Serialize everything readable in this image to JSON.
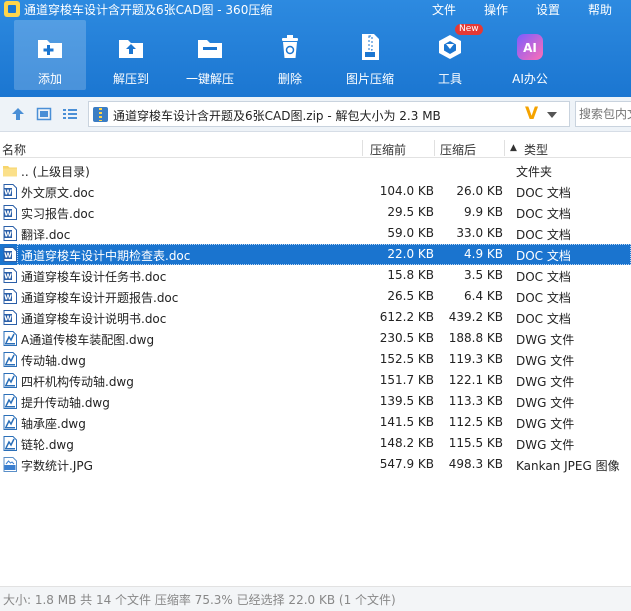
{
  "window": {
    "title": "通道穿梭车设计含开题及6张CAD图 - 360压缩"
  },
  "menu": {
    "file": "文件",
    "action": "操作",
    "settings": "设置",
    "help": "帮助"
  },
  "toolbar": {
    "add": "添加",
    "extract_to": "解压到",
    "one_click_extract": "一键解压",
    "delete": "删除",
    "image_compress": "图片压缩",
    "tools": "工具",
    "tools_badge": "New",
    "ai_office": "AI办公",
    "ai_icon_text": "AI"
  },
  "address": {
    "path": "通道穿梭车设计含开题及6张CAD图.zip - 解包大小为 2.3 MB",
    "v_glyph": "V",
    "search_placeholder": "搜索包内文件"
  },
  "columns": {
    "name": "名称",
    "size_before": "压缩前",
    "size_after": "压缩后",
    "sort_arrow": "▲",
    "type": "类型"
  },
  "files": [
    {
      "icon": "folder-icon",
      "name": ".. (上级目录)",
      "size": "",
      "compressed": "",
      "type": "文件夹"
    },
    {
      "icon": "word-doc-icon",
      "name": "外文原文.doc",
      "size": "104.0 KB",
      "compressed": "26.0 KB",
      "type": "DOC 文档"
    },
    {
      "icon": "word-doc-icon",
      "name": "实习报告.doc",
      "size": "29.5 KB",
      "compressed": "9.9 KB",
      "type": "DOC 文档"
    },
    {
      "icon": "word-doc-icon",
      "name": "翻译.doc",
      "size": "59.0 KB",
      "compressed": "33.0 KB",
      "type": "DOC 文档"
    },
    {
      "icon": "word-doc-icon",
      "name": "通道穿梭车设计中期检查表.doc",
      "size": "22.0 KB",
      "compressed": "4.9 KB",
      "type": "DOC 文档",
      "selected": true
    },
    {
      "icon": "word-doc-icon",
      "name": "通道穿梭车设计任务书.doc",
      "size": "15.8 KB",
      "compressed": "3.5 KB",
      "type": "DOC 文档"
    },
    {
      "icon": "word-doc-icon",
      "name": "通道穿梭车设计开题报告.doc",
      "size": "26.5 KB",
      "compressed": "6.4 KB",
      "type": "DOC 文档"
    },
    {
      "icon": "word-doc-icon",
      "name": "通道穿梭车设计说明书.doc",
      "size": "612.2 KB",
      "compressed": "439.2 KB",
      "type": "DOC 文档"
    },
    {
      "icon": "dwg-file-icon",
      "name": "A通道传梭车装配图.dwg",
      "size": "230.5 KB",
      "compressed": "188.8 KB",
      "type": "DWG 文件"
    },
    {
      "icon": "dwg-file-icon",
      "name": "传动轴.dwg",
      "size": "152.5 KB",
      "compressed": "119.3 KB",
      "type": "DWG 文件"
    },
    {
      "icon": "dwg-file-icon",
      "name": "四杆机构传动轴.dwg",
      "size": "151.7 KB",
      "compressed": "122.1 KB",
      "type": "DWG 文件"
    },
    {
      "icon": "dwg-file-icon",
      "name": "提升传动轴.dwg",
      "size": "139.5 KB",
      "compressed": "113.3 KB",
      "type": "DWG 文件"
    },
    {
      "icon": "dwg-file-icon",
      "name": "轴承座.dwg",
      "size": "141.5 KB",
      "compressed": "112.5 KB",
      "type": "DWG 文件"
    },
    {
      "icon": "dwg-file-icon",
      "name": "链轮.dwg",
      "size": "148.2 KB",
      "compressed": "115.5 KB",
      "type": "DWG 文件"
    },
    {
      "icon": "jpeg-file-icon",
      "name": "字数统计.JPG",
      "size": "547.9 KB",
      "compressed": "498.3 KB",
      "type": "Kankan JPEG 图像"
    }
  ],
  "status": {
    "text": "大小: 1.8 MB 共 14 个文件 压缩率 75.3% 已经选择 22.0 KB (1 个文件)"
  },
  "colors": {
    "toolbar_blue": "#1b76d1",
    "selection_blue": "#1a74cf",
    "accent_yellow": "#ffd54a",
    "v_orange": "#f5a300"
  }
}
